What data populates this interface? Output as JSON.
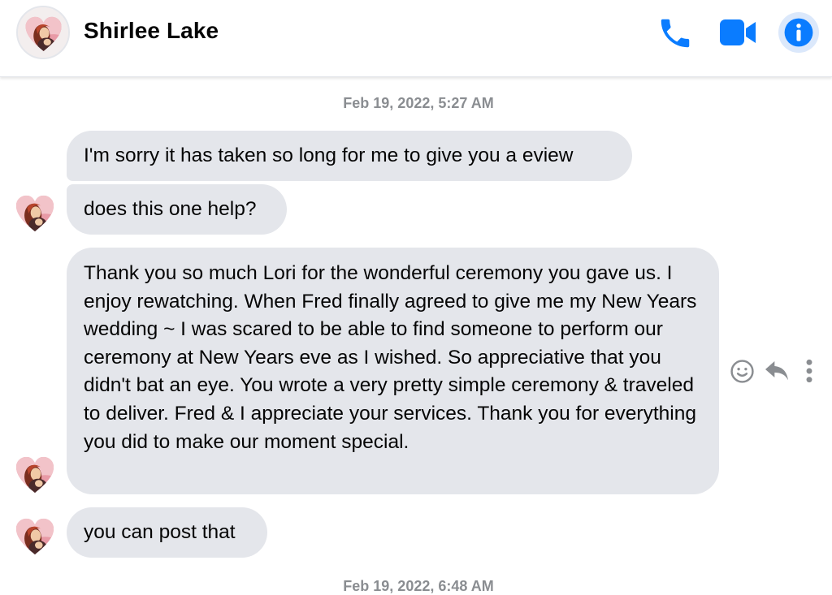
{
  "header": {
    "contact_name": "Shirlee Lake",
    "icons": [
      "phone-icon",
      "video-camera-icon",
      "info-icon"
    ],
    "accent_color": "#0a7cff"
  },
  "conversation": {
    "timestamp": "Feb 19, 2022, 5:27 AM",
    "next_timestamp_partial": "Feb 19, 2022, 6:48 AM",
    "messages": [
      {
        "sender": "Shirlee Lake",
        "text": "I'm sorry it has taken so long for me to give you a eview"
      },
      {
        "sender": "Shirlee Lake",
        "text": "does this one help?"
      },
      {
        "sender": "Shirlee Lake",
        "text": "Thank you so much Lori for the wonderful ceremony you gave us. I enjoy rewatching.  When Fred finally agreed to give me my New Years wedding ~ I was scared to be able to find someone to perform our ceremony at New Years eve as I wished.  So appreciative that you didn't bat an eye. You wrote a very pretty simple ceremony  & traveled  to deliver.   Fred & I appreciate your services.   Thank you for everything you did to make our moment special."
      },
      {
        "sender": "Shirlee Lake",
        "text": "you can post that"
      }
    ],
    "message_actions": [
      "react-icon",
      "reply-icon",
      "more-options-icon"
    ],
    "bubble_color": "#e4e6eb"
  }
}
